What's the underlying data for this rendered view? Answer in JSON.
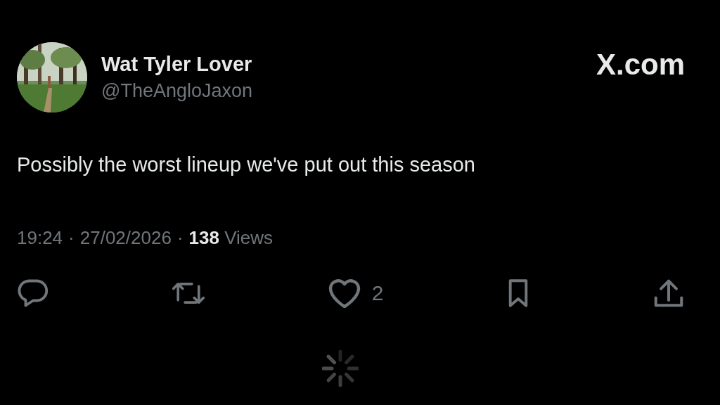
{
  "post": {
    "author": {
      "name": "Wat Tyler Lover",
      "handle": "@TheAngloJaxon"
    },
    "brand": "X.com",
    "text": "Possibly the worst lineup we've put out this season",
    "time": "19:24",
    "date": "27/02/2026",
    "views_count": "138",
    "views_label": "Views",
    "separator": "·"
  },
  "actions": [
    {
      "kind": "reply"
    },
    {
      "kind": "repost"
    },
    {
      "kind": "like",
      "count": "2"
    },
    {
      "kind": "bookmark"
    },
    {
      "kind": "share"
    }
  ]
}
